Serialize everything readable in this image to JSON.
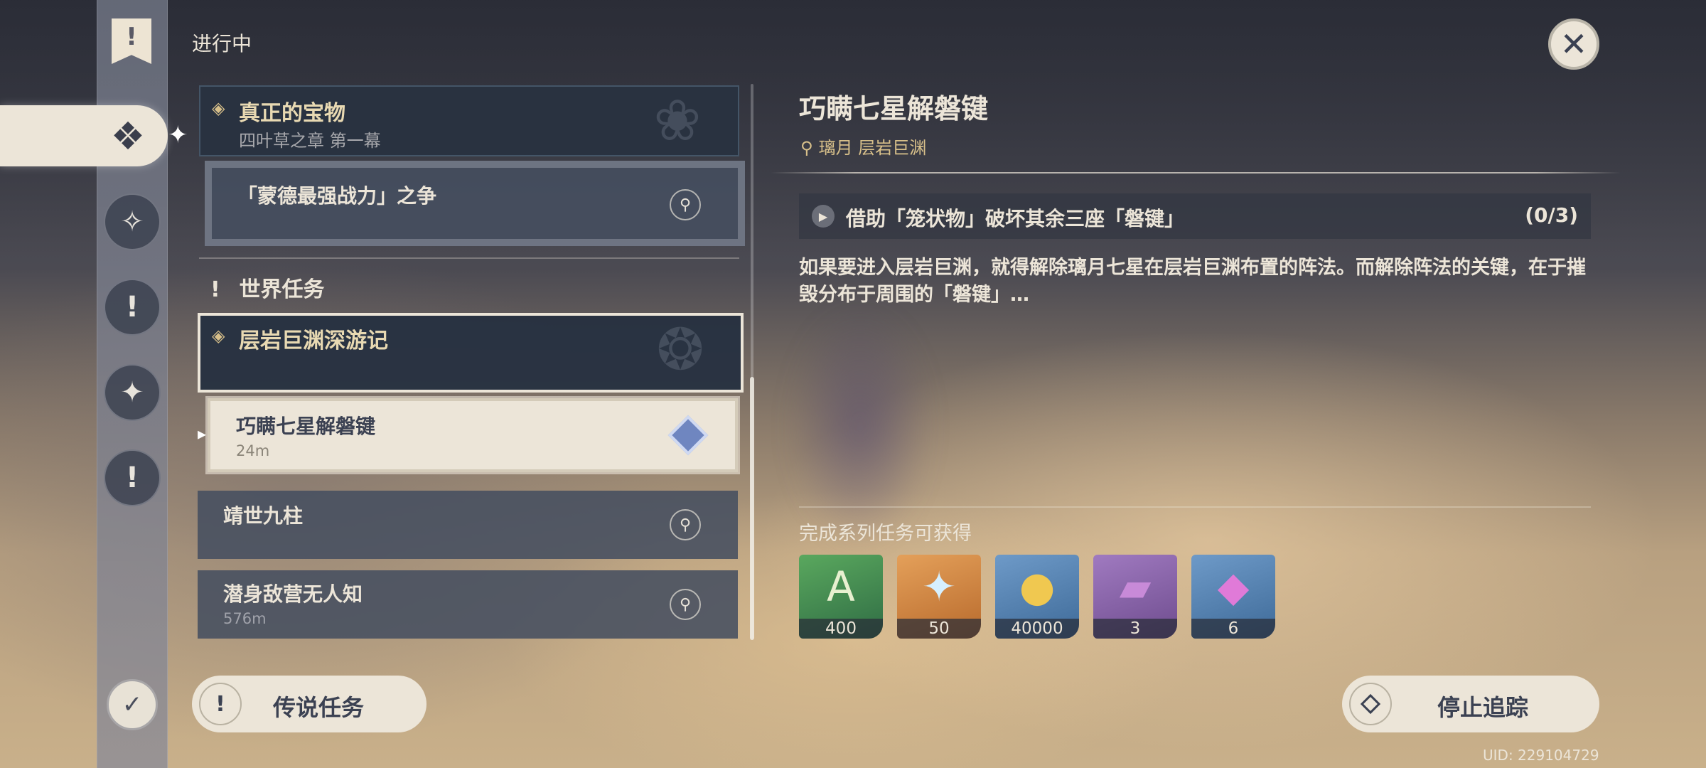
{
  "header": {
    "section_label": "进行中"
  },
  "sidebar": {
    "categories": [
      {
        "icon": "archon-quest-icon",
        "selected": true
      },
      {
        "icon": "story-quest-icon"
      },
      {
        "icon": "world-quest-icon"
      },
      {
        "icon": "event-quest-icon"
      },
      {
        "icon": "commission-icon"
      }
    ],
    "bottom_icon": "quest-book-icon"
  },
  "quest_list": {
    "group1": {
      "title": "真正的宝物",
      "subtitle": "四叶草之章 第一幕",
      "items": [
        {
          "title": "「蒙德最强战力」之争",
          "distance": ""
        }
      ]
    },
    "world_heading": "世界任务",
    "group2": {
      "title": "层岩巨渊深游记",
      "selected_item": {
        "title": "巧瞒七星解磐键",
        "distance": "24m"
      },
      "items": [
        {
          "title": "靖世九柱",
          "distance": ""
        },
        {
          "title": "潜身敌营无人知",
          "distance": "576m"
        }
      ]
    }
  },
  "detail": {
    "title": "巧瞒七星解磐键",
    "location": "璃月 层岩巨渊",
    "objective": "借助「笼状物」破坏其余三座「磐键」",
    "objective_count": "(0/3)",
    "description": "如果要进入层岩巨渊，就得解除璃月七星在层岩巨渊布置的阵法。而解除阵法的关键，在于摧毁分布于周围的「磐键」…",
    "reward_label": "完成系列任务可获得",
    "rewards": [
      {
        "icon": "adventure-exp-icon",
        "qty": "400",
        "color": "#3f8a4e"
      },
      {
        "icon": "primogem-icon",
        "qty": "50",
        "color": "#d88a3a"
      },
      {
        "icon": "mora-icon",
        "qty": "40000",
        "color": "#5a86b8"
      },
      {
        "icon": "heros-wit-icon",
        "qty": "3",
        "color": "#8a64a8"
      },
      {
        "icon": "mystic-ore-icon",
        "qty": "6",
        "color": "#5a86b8"
      }
    ]
  },
  "buttons": {
    "legend_quests": "传说任务",
    "stop_tracking": "停止追踪"
  },
  "uid": "UID: 229104729"
}
